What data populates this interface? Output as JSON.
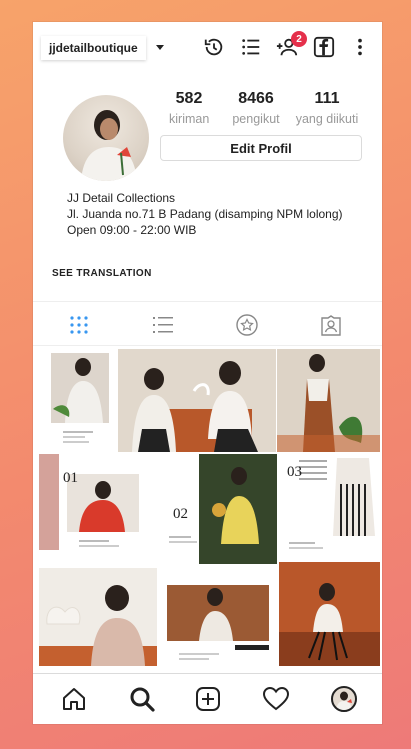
{
  "header": {
    "username": "jjdetailboutique",
    "notification_count": "2"
  },
  "profile": {
    "stats": [
      {
        "value": "582",
        "label": "kiriman"
      },
      {
        "value": "8466",
        "label": "pengikut"
      },
      {
        "value": "111",
        "label": "yang diikuti"
      }
    ],
    "edit_label": "Edit Profil",
    "bio": [
      "JJ Detail Collections",
      "Jl. Juanda no.71 B Padang (disamping NPM lolong)",
      "Open 09:00 - 22:00 WIB"
    ],
    "see_translation": "SEE TRANSLATION"
  },
  "grid": {
    "labels": [
      "01",
      "02",
      "03"
    ]
  },
  "colors": {
    "badge": "#e5304b",
    "tab_active": "#3897f0",
    "accent_orange": "#c4602f"
  }
}
